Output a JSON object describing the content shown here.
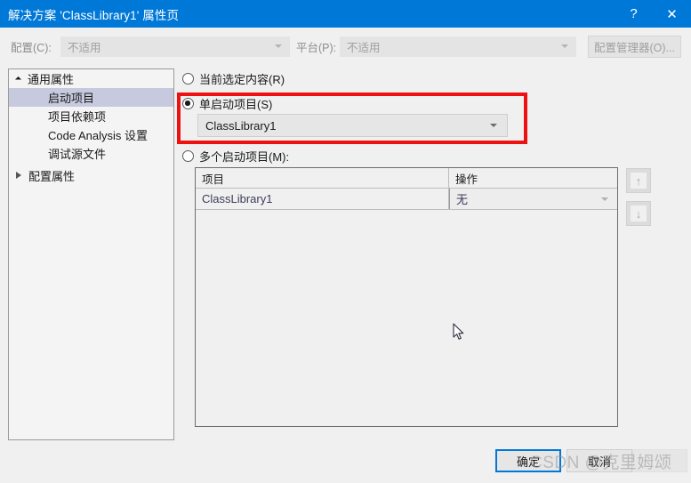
{
  "window": {
    "title": "解决方案 'ClassLibrary1' 属性页",
    "help_icon": "?",
    "close_icon": "✕"
  },
  "toolbar": {
    "config_label": "配置(C):",
    "config_value": "不适用",
    "platform_label": "平台(P):",
    "platform_value": "不适用",
    "config_manager_button": "配置管理器(O)..."
  },
  "tree": {
    "items": [
      {
        "label": "通用属性",
        "level": 0,
        "expanded": true,
        "selected": false
      },
      {
        "label": "启动项目",
        "level": 1,
        "expanded": false,
        "selected": true
      },
      {
        "label": "项目依赖项",
        "level": 1,
        "expanded": false,
        "selected": false
      },
      {
        "label": "Code Analysis 设置",
        "level": 1,
        "expanded": false,
        "selected": false
      },
      {
        "label": "调试源文件",
        "level": 1,
        "expanded": false,
        "selected": false
      },
      {
        "label": "配置属性",
        "level": 0,
        "expanded": false,
        "selected": false
      }
    ]
  },
  "startup": {
    "option_current": "当前选定内容(R)",
    "option_single": "单启动项目(S)",
    "option_multiple": "多个启动项目(M):",
    "selected_option": "single",
    "single_project_value": "ClassLibrary1"
  },
  "table": {
    "columns": [
      "项目",
      "操作"
    ],
    "rows": [
      {
        "project": "ClassLibrary1",
        "action": "无"
      }
    ]
  },
  "side_buttons": {
    "move_up_icon": "↑",
    "move_down_icon": "↓"
  },
  "footer": {
    "ok_button": "确定",
    "cancel_button": "取消",
    "apply_button": ""
  },
  "watermark": {
    "text": "CSDN @克里姆颂"
  },
  "colors": {
    "titlebar": "#0078d7",
    "annotation": "#ee1111",
    "selection": "#c7cade",
    "dialog_bg": "#f0f0f0"
  }
}
